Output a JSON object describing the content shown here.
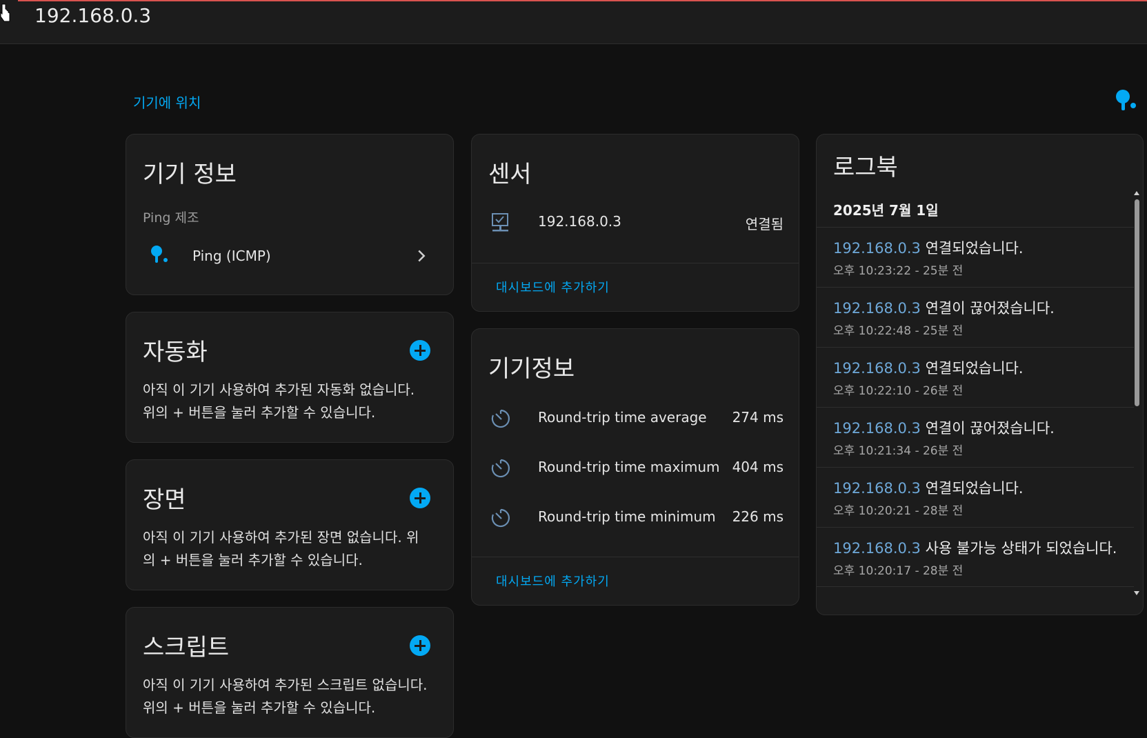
{
  "header": {
    "title": "192.168.0.3"
  },
  "area_link": "기기에 위치",
  "device_info": {
    "title": "기기 정보",
    "manufacturer": "Ping 제조",
    "integration_label": "Ping (ICMP)"
  },
  "automation": {
    "title": "자동화",
    "empty_line1": "아직 이 기기 사용하여 추가된 자동화 없습니다.",
    "empty_line2": "위의 + 버튼을 눌러 추가할 수 있습니다."
  },
  "scene": {
    "title": "장면",
    "empty_line1": "아직 이 기기 사용하여 추가된 장면 없습니다. 위",
    "empty_line2": "의 + 버튼을 눌러 추가할 수 있습니다."
  },
  "script": {
    "title": "스크립트",
    "empty_line1": "아직 이 기기 사용하여 추가된 스크립트 없습니다.",
    "empty_line2": "위의 + 버튼을 눌러 추가할 수 있습니다."
  },
  "sensors": {
    "title": "센서",
    "rows": [
      {
        "name": "192.168.0.3",
        "state": "연결됨",
        "icon": "lan-connect-icon"
      }
    ],
    "add_to_dashboard": "대시보드에 추가하기"
  },
  "diagnostics": {
    "title": "기기정보",
    "rows": [
      {
        "name": "Round-trip time average",
        "value": "274 ms",
        "icon": "timer-icon"
      },
      {
        "name": "Round-trip time maximum",
        "value": "404 ms",
        "icon": "timer-icon"
      },
      {
        "name": "Round-trip time minimum",
        "value": "226 ms",
        "icon": "timer-icon"
      }
    ],
    "add_to_dashboard": "대시보드에 추가하기"
  },
  "logbook": {
    "title": "로그북",
    "date": "2025년 7월 1일",
    "entries": [
      {
        "entity": "192.168.0.3",
        "message": "연결되었습니다.",
        "time": "오후 10:23:22 - 25분 전"
      },
      {
        "entity": "192.168.0.3",
        "message": "연결이 끊어졌습니다.",
        "time": "오후 10:22:48 - 25분 전"
      },
      {
        "entity": "192.168.0.3",
        "message": "연결되었습니다.",
        "time": "오후 10:22:10 - 26분 전"
      },
      {
        "entity": "192.168.0.3",
        "message": "연결이 끊어졌습니다.",
        "time": "오후 10:21:34 - 26분 전"
      },
      {
        "entity": "192.168.0.3",
        "message": "연결되었습니다.",
        "time": "오후 10:20:21 - 28분 전"
      },
      {
        "entity": "192.168.0.3",
        "message": "사용 불가능 상태가 되었습니다.",
        "time": "오후 10:20:17 - 28분 전"
      }
    ]
  },
  "colors": {
    "accent": "#03a9f4",
    "background": "#111111",
    "card": "#1c1c1c",
    "entity_link": "#6ea8d8"
  }
}
